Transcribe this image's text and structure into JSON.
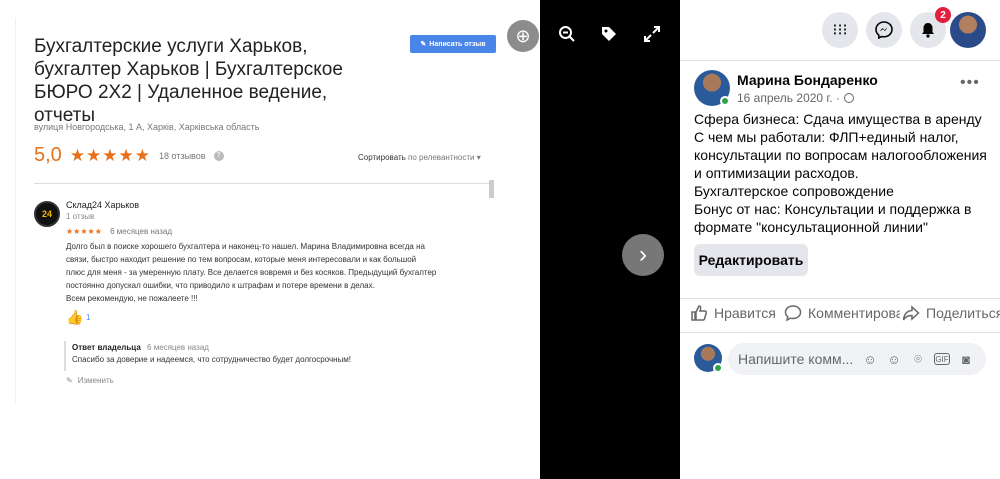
{
  "review_photo": {
    "business_title": "Бухгалтерские услуги Харьков, бухгалтер Харьков | Бухгалтерское БЮРО 2Х2 | Удаленное ведение, отчеты",
    "write_review_label": "Написать отзыв",
    "address": "вулиця Новгородська, 1 А, Харків, Харківська область",
    "rating": "5,0",
    "stars": "★★★★★",
    "review_count": "18 отзывов",
    "sort_label": "Сортировать",
    "sort_value": "по релевантности",
    "reviewer_logo": "24",
    "reviewer_name": "Склад24 Харьков",
    "reviewer_sub": "1 отзыв",
    "review_stars": "★★★★★",
    "review_ago": "6 месяцев назад",
    "review_text_lines": [
      "Долго был в поиске хорошего бухгалтера и наконец-то нашел. Марина Владимировна всегда на",
      "связи, быстро находит решение по тем вопросам, которые меня интересовали и как большой",
      "плюс для меня - за умеренную плату. Все делается вовремя и без косяков. Предыдущий бухгалтер",
      "постоянно допускал ошибки, что приводило к штрафам и потере времени в делах.",
      "Всем рекомендую, не пожалеете !!!"
    ],
    "like_count": "1",
    "owner_label": "Ответ владельца",
    "owner_ago": "6 месяцев назад",
    "owner_text": "Спасибо за доверие и надеемся, что сотрудничество будет долгосрочным!",
    "edit_label": "Изменить"
  },
  "viewer": {
    "zoom_in_icon": "zoom-in-icon",
    "zoom_out_icon": "zoom-out-icon",
    "tag_icon": "tag-icon",
    "fullscreen_icon": "fullscreen-icon",
    "next_icon": "chevron-right-icon"
  },
  "top_bar": {
    "notifications_count": "2"
  },
  "post": {
    "author": "Марина Бондаренко",
    "date": "16 апрель 2020 г. ·",
    "text_lines": [
      "Сфера бизнеса: Сдача имущества в аренду",
      "С чем мы работали: ФЛП+единый налог,",
      "консультации по вопросам налогообложения",
      "и оптимизации расходов.",
      "Бухгалтерское сопровождение",
      "Бонус от нас: Консультации и поддержка в",
      "формате \"консультационной линии\""
    ],
    "edit_button": "Редактировать",
    "actions": {
      "like": "Нравится",
      "comment": "Комментировать",
      "share": "Поделиться"
    },
    "comment_placeholder": "Напишите комм..."
  },
  "colors": {
    "google_orange": "#e7711b",
    "google_blue": "#4a86e8",
    "fb_badge": "#e41e3f",
    "fb_online": "#31a24c"
  }
}
